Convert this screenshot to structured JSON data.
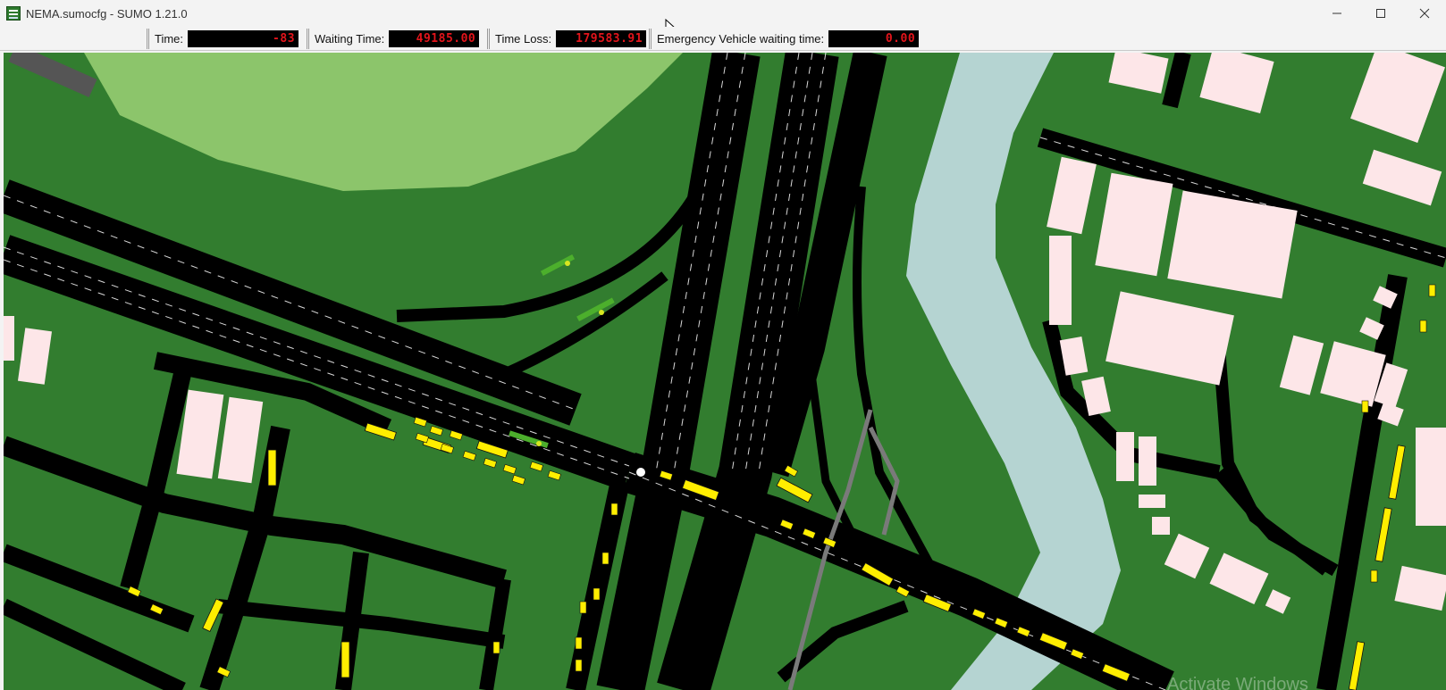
{
  "window": {
    "title": "NEMA.sumocfg - SUMO 1.21.0",
    "minimize_icon": "minimize-icon",
    "maximize_icon": "maximize-icon",
    "close_icon": "close-icon"
  },
  "toolbar": {
    "time_label": "Time:",
    "time_value": "-83",
    "waiting_label": "Waiting Time:",
    "waiting_value": "49185.00",
    "timeloss_label": "Time Loss:",
    "timeloss_value": "179583.91",
    "emergency_label": "Emergency Vehicle waiting time:",
    "emergency_value": "0.00"
  },
  "colors": {
    "grass": "#327d2f",
    "park": "#8cc56b",
    "road": "#000000",
    "water": "#b5d4d2",
    "building": "#fde6e8",
    "vehicle": "#ffee00",
    "lcd_text": "#e3141b"
  },
  "overlay": {
    "watermark": "Activate Windows"
  }
}
